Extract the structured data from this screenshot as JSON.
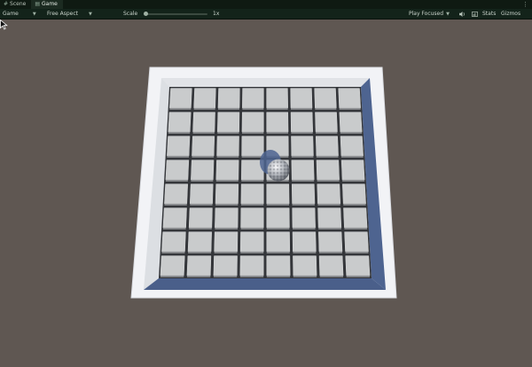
{
  "tabs": [
    {
      "label": "Scene",
      "icon": "scene-icon",
      "active": false
    },
    {
      "label": "Game",
      "icon": "game-icon",
      "active": true
    }
  ],
  "toolbar": {
    "display": "Game",
    "aspect": "Free Aspect",
    "scale_label": "Scale",
    "scale_value": "1x",
    "play_mode": "Play Focused",
    "stats_label": "Stats",
    "gizmos_label": "Gizmos"
  },
  "icons": {
    "options": "menu-dots-icon",
    "audio": "speaker-icon",
    "stats": "stats-icon",
    "cursor": "mouse-cursor-icon",
    "ball": "sphere-icon"
  },
  "colors": {
    "tabbar_bg": "#0f1a12",
    "toolbar_bg": "#13231a",
    "viewport_bg": "#5f5752",
    "board_frame": "#f2f3f6",
    "tile": "#c9cbcc",
    "wall_shadow": "#4e6490"
  },
  "board": {
    "rows": 8,
    "cols": 8,
    "ball_row": 3,
    "ball_col": 4
  }
}
